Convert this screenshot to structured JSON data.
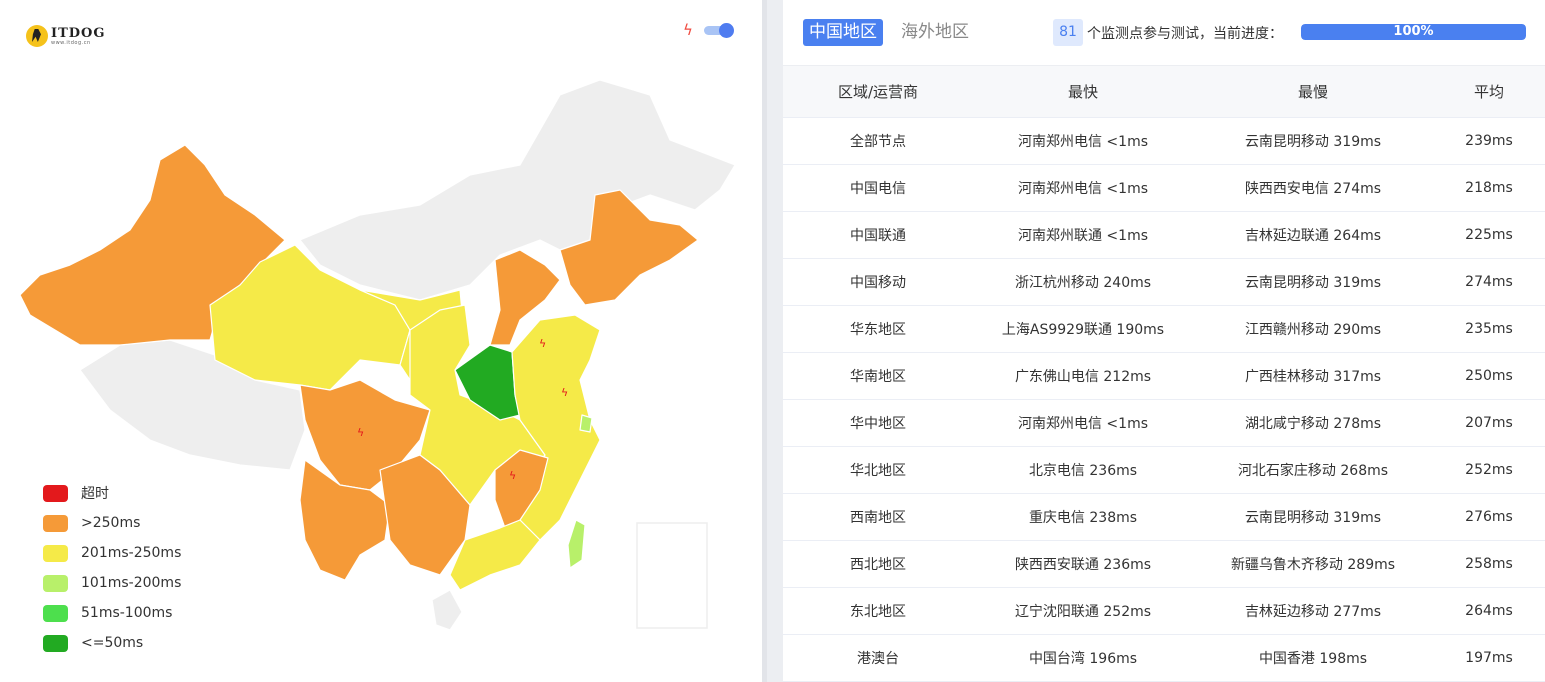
{
  "logo": {
    "title": "ITDOG",
    "subtitle": "www.itdog.cn"
  },
  "map_controls": {
    "icon": "lightning-icon",
    "toggle_on": true
  },
  "colors": {
    "timeout": "#e3191c",
    "over_250": "#f59a38",
    "r201_250": "#f5ea48",
    "r101_200": "#b8f06a",
    "r51_100": "#4ddf4d",
    "le_50": "#22aa22",
    "no_data": "#eeeeee",
    "accent": "#4a80f0"
  },
  "legend": [
    {
      "label": "超时",
      "color": "#e3191c"
    },
    {
      "label": ">250ms",
      "color": "#f59a38"
    },
    {
      "label": "201ms-250ms",
      "color": "#f5ea48"
    },
    {
      "label": "101ms-200ms",
      "color": "#b8f06a"
    },
    {
      "label": "51ms-100ms",
      "color": "#4ddf4d"
    },
    {
      "label": "<=50ms",
      "color": "#22aa22"
    }
  ],
  "tabs": {
    "active": "中国地区",
    "inactive": "海外地区"
  },
  "progress": {
    "node_count": "81",
    "text": "个监测点参与测试，当前进度：",
    "percent_label": "100%",
    "value": 1.0
  },
  "table": {
    "headers": [
      "区域/运营商",
      "最快",
      "最慢",
      "平均"
    ],
    "rows": [
      [
        "全部节点",
        "河南郑州电信 <1ms",
        "云南昆明移动 319ms",
        "239ms"
      ],
      [
        "中国电信",
        "河南郑州电信 <1ms",
        "陕西西安电信 274ms",
        "218ms"
      ],
      [
        "中国联通",
        "河南郑州联通 <1ms",
        "吉林延边联通 264ms",
        "225ms"
      ],
      [
        "中国移动",
        "浙江杭州移动 240ms",
        "云南昆明移动 319ms",
        "274ms"
      ],
      [
        "华东地区",
        "上海AS9929联通 190ms",
        "江西赣州移动 290ms",
        "235ms"
      ],
      [
        "华南地区",
        "广东佛山电信 212ms",
        "广西桂林移动 317ms",
        "250ms"
      ],
      [
        "华中地区",
        "河南郑州电信 <1ms",
        "湖北咸宁移动 278ms",
        "207ms"
      ],
      [
        "华北地区",
        "北京电信 236ms",
        "河北石家庄移动 268ms",
        "252ms"
      ],
      [
        "西南地区",
        "重庆电信 238ms",
        "云南昆明移动 319ms",
        "276ms"
      ],
      [
        "西北地区",
        "陕西西安联通 236ms",
        "新疆乌鲁木齐移动 289ms",
        "258ms"
      ],
      [
        "东北地区",
        "辽宁沈阳联通 252ms",
        "吉林延边移动 277ms",
        "264ms"
      ],
      [
        "港澳台",
        "中国台湾 196ms",
        "中国香港 198ms",
        "197ms"
      ]
    ]
  }
}
